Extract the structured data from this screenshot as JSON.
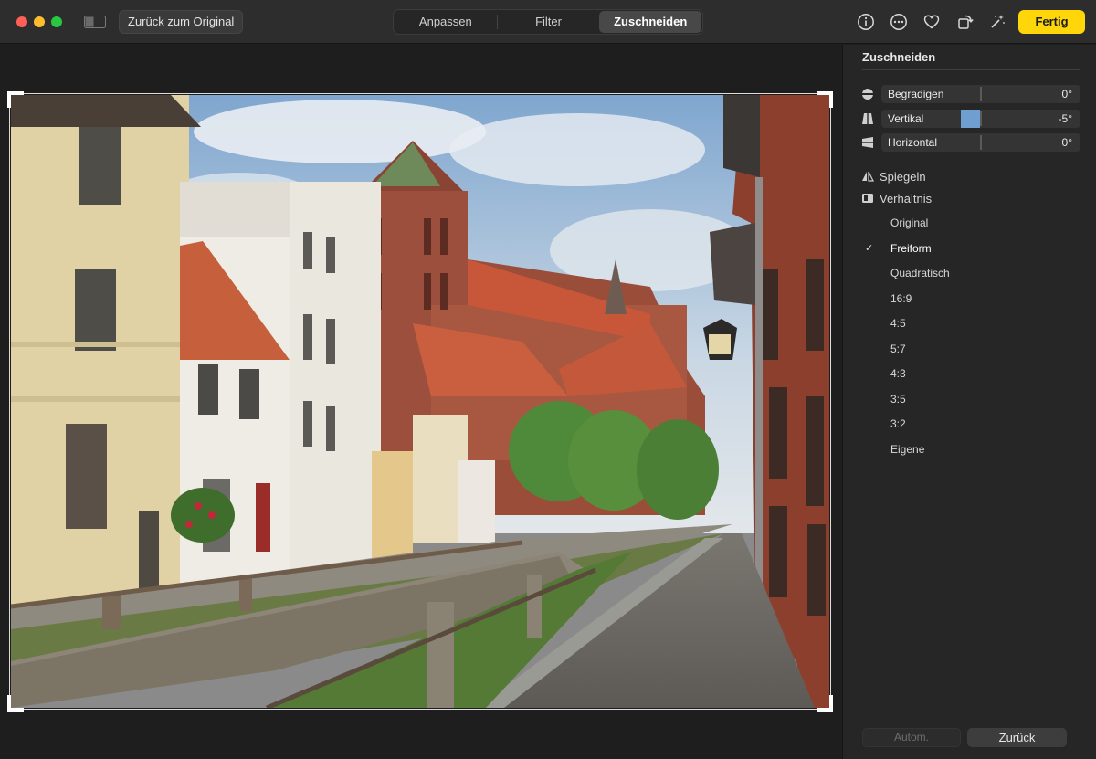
{
  "window": {
    "revert_label": "Zurück zum Original",
    "done_label": "Fertig",
    "tabs": [
      {
        "label": "Anpassen",
        "active": false
      },
      {
        "label": "Filter",
        "active": false
      },
      {
        "label": "Zuschneiden",
        "active": true
      }
    ],
    "toolbar_icons": [
      "info-icon",
      "more-icon",
      "heart-icon",
      "rotate-icon",
      "magic-wand-icon"
    ],
    "accent_color": "#ffd60a"
  },
  "panel": {
    "title": "Zuschneiden",
    "adjustments": [
      {
        "label": "Begradigen",
        "value": "0°",
        "level": 0
      },
      {
        "label": "Vertikal",
        "value": "-5°",
        "level": -5
      },
      {
        "label": "Horizontal",
        "value": "0°",
        "level": 0
      }
    ],
    "mirror_label": "Spiegeln",
    "ratio_label": "Verhältnis",
    "ratios": [
      {
        "label": "Original",
        "checked": false
      },
      {
        "label": "Freiform",
        "checked": true
      },
      {
        "label": "Quadratisch",
        "checked": false
      },
      {
        "label": "16:9",
        "checked": false
      },
      {
        "label": "4:5",
        "checked": false
      },
      {
        "label": "5:7",
        "checked": false
      },
      {
        "label": "4:3",
        "checked": false
      },
      {
        "label": "3:5",
        "checked": false
      },
      {
        "label": "3:2",
        "checked": false
      },
      {
        "label": "Eigene",
        "checked": false
      }
    ],
    "check_mark": "✓",
    "auto_label": "Autom.",
    "back_label": "Zurück"
  }
}
